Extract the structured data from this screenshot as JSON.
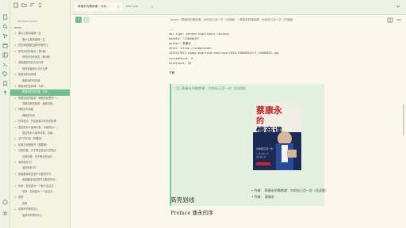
{
  "sidebar": {
    "vault_name": "WeRead-Vault",
    "items": [
      {
        "label": "books",
        "indent": 0,
        "arrow": "▾"
      },
      {
        "label": "股价让投资者那一生",
        "indent": 1,
        "arrow": "▾"
      },
      {
        "label": "股价让投资者那一生",
        "indent": 2,
        "arrow": ""
      },
      {
        "label": "把生命值赚在最好的零时上",
        "indent": 1,
        "arrow": "▸"
      },
      {
        "label": "把时间当作朋友（第3版）",
        "indent": 1,
        "arrow": "▾"
      },
      {
        "label": "把时间当作朋友（第3版）",
        "indent": 2,
        "arrow": ""
      },
      {
        "label": "我就是嘴巴在今天中作",
        "indent": 1,
        "arrow": "▾"
      },
      {
        "label": "别好家被你从今中过梦",
        "indent": 2,
        "arrow": ""
      },
      {
        "label": "蔡康永的情商课",
        "indent": 1,
        "arrow": "▾"
      },
      {
        "label": "蔡康永的情商课",
        "indent": 2,
        "arrow": ""
      },
      {
        "label": "蔡康永的情商课：为你…",
        "indent": 1,
        "arrow": "▾"
      },
      {
        "label": "蔡康永的情商课：为你…",
        "indent": 2,
        "arrow": "",
        "active": true
      },
      {
        "label": "苏格拉底的智慧：朝宾系统里的一…",
        "indent": 1,
        "arrow": "▾"
      },
      {
        "label": "苏格拉底的智慧：朝宾系统…",
        "indent": 2,
        "arrow": ""
      },
      {
        "label": "神秘的马戏团",
        "indent": 1,
        "arrow": "▾"
      },
      {
        "label": "神秘的马戏",
        "indent": 2,
        "arrow": ""
      },
      {
        "label": "在村帖记：开启深度与未来的精神",
        "indent": 1,
        "arrow": "▸"
      },
      {
        "label": "君这样对人最有可能，中级能为一…",
        "indent": 1,
        "arrow": "▾"
      },
      {
        "label": "君这样对人最有可能，中级…",
        "indent": 2,
        "arrow": ""
      },
      {
        "label": "当下的力量（珍藏版）",
        "indent": 1,
        "arrow": "▸"
      },
      {
        "label": "给我文化程度书（典藏版）",
        "indent": 1,
        "arrow": "▸"
      },
      {
        "label": "沉默的盘：关于教友型运行的观点",
        "indent": 1,
        "arrow": "▾"
      },
      {
        "label": "沉默的盘：关于教友型运行…",
        "indent": 2,
        "arrow": ""
      },
      {
        "label": "谁的软件行？",
        "indent": 1,
        "arrow": "▾"
      },
      {
        "label": "谁的软件行？",
        "indent": 2,
        "arrow": ""
      },
      {
        "label": "我就翻译成这是不可能的时代",
        "indent": 1,
        "arrow": "▾"
      },
      {
        "label": "我就翻译成这是不可能的时代…",
        "indent": 2,
        "arrow": ""
      },
      {
        "label": "情商：如何因为一个两人这点方…",
        "indent": 1,
        "arrow": "▾"
      },
      {
        "label": "情商：如何因为一个这点方…",
        "indent": 2,
        "arrow": ""
      },
      {
        "label": "夏夜",
        "indent": 1,
        "arrow": "▾"
      },
      {
        "label": "夏夜",
        "indent": 2,
        "arrow": ""
      },
      {
        "label": "给我年外那件约入",
        "indent": 1,
        "arrow": "▸"
      },
      {
        "label": "给我年外那件约入",
        "indent": 2,
        "arrow": ""
      }
    ]
  },
  "tabs": [
    {
      "label": "蔡康永的情商课：为你…",
      "active": true
    },
    {
      "label": "New tab",
      "active": false
    }
  ],
  "breadcrumb": "books / 蔡康永的情商课：为你自己活一次（试读版） / 蔡康永的情商课：为你自己活一次（试读版）",
  "frontmatter": {
    "open": "---",
    "doc_type": "doc_type: weread-highlights-reviews",
    "bookid": "bookId: \"23600653\"",
    "author": "author: 蔡康永",
    "cover": "cover: https://wfqqreader-",
    "cover2": "1252317822.image.myqcloud.com/cover/653/23600653/t7_23600653.jpg",
    "review": "reviewCount: 2",
    "note": "noteCount: 36",
    "close": "---"
  },
  "section_label": "书籍",
  "callout": {
    "title": "蔡康永的情商课：为你自己活一次（试读版）",
    "author_line": "• 作者： 蔡康永的情商课：为你自己活一次（试读版）",
    "author_line2": "• 作者： 蔡康永"
  },
  "book_cover": {
    "title_text": "蔡康永的情商课",
    "color_bg": "#1b2a57",
    "color_top": "#f0eee4",
    "color_title": "#c0282b"
  },
  "headings": {
    "h1": "高亮划线",
    "h2": "Preface 康永的序"
  },
  "colors": {
    "accent": "#6fbf8e",
    "callout_bg": "#e4f0df",
    "page_bg": "#fbf7ea"
  }
}
